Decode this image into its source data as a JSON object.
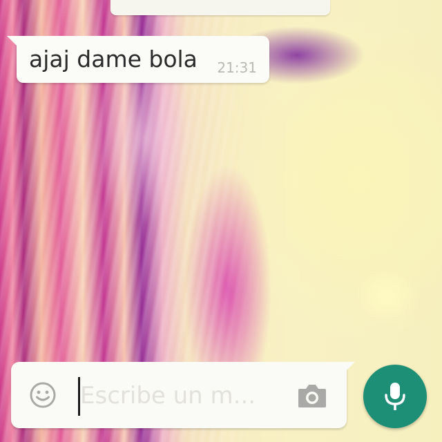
{
  "chat": {
    "messages": [
      {
        "direction": "incoming",
        "text": "ajaj dame bola",
        "time": "21:31"
      }
    ]
  },
  "composer": {
    "placeholder": "Escribe un m...",
    "value": "",
    "emoji_icon": "smiley-face-icon",
    "camera_icon": "camera-icon",
    "send_icon": "microphone-icon"
  },
  "colors": {
    "accent": "#1d8f76",
    "bubble_in": "#fbfbf7",
    "input_bg": "#fafaf6",
    "timestamp": "#b9b9b4",
    "placeholder": "#e3e1dc"
  }
}
